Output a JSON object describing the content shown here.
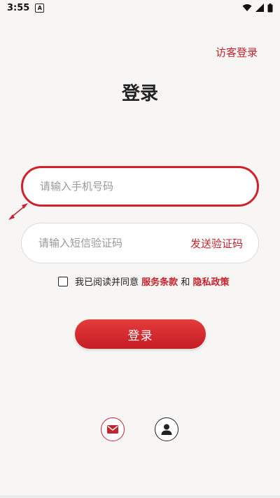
{
  "statusbar": {
    "time": "3:55",
    "app_icon_letter": "A",
    "icons": [
      "wifi-icon",
      "signal-icon",
      "battery-icon"
    ]
  },
  "guest_login": "访客登录",
  "title": "登录",
  "phone_field": {
    "placeholder": "请输入手机号码",
    "value": ""
  },
  "code_field": {
    "placeholder": "请输入短信验证码",
    "value": "",
    "send_code_label": "发送验证码"
  },
  "agreement": {
    "checked": false,
    "prefix": "我已阅读并同意",
    "terms": "服务条款",
    "and": "和",
    "privacy": "隐私政策"
  },
  "login_button": "登录",
  "bottom_icons": [
    "mail-icon",
    "user-icon"
  ],
  "colors": {
    "accent": "#c8232c",
    "background": "#f7f6f5"
  }
}
